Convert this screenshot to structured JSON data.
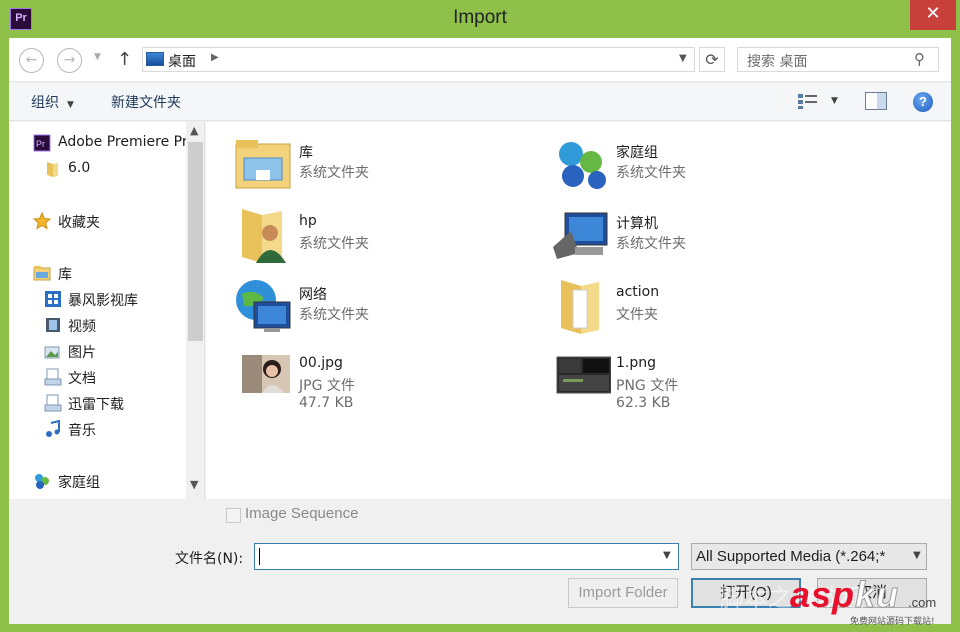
{
  "window": {
    "title": "Import",
    "app_icon_text": "Pr",
    "close_glyph": "✕"
  },
  "nav": {
    "back_glyph": "←",
    "forward_glyph": "→",
    "up_glyph": "↑",
    "address_path": "桌面",
    "refresh_glyph": "⟳",
    "search_placeholder": "搜索 桌面"
  },
  "toolbar": {
    "organize_label": "组织",
    "new_folder_label": "新建文件夹",
    "help_glyph": "?"
  },
  "sidebar": {
    "items": [
      {
        "label": "Adobe Premiere Pro",
        "icon": "premiere-icon"
      },
      {
        "label": "6.0",
        "icon": "folder-icon"
      },
      {
        "label": "收藏夹",
        "icon": "star-icon"
      },
      {
        "label": "库",
        "icon": "library-icon"
      },
      {
        "label": "暴风影视库",
        "icon": "video-library-icon"
      },
      {
        "label": "视频",
        "icon": "video-icon"
      },
      {
        "label": "图片",
        "icon": "pictures-icon"
      },
      {
        "label": "文档",
        "icon": "documents-icon"
      },
      {
        "label": "迅雷下载",
        "icon": "download-icon"
      },
      {
        "label": "音乐",
        "icon": "music-icon"
      },
      {
        "label": "家庭组",
        "icon": "homegroup-icon"
      }
    ]
  },
  "files": [
    {
      "name": "库",
      "type": "系统文件夹",
      "icon": "library-folder-icon"
    },
    {
      "name": "家庭组",
      "type": "系统文件夹",
      "icon": "homegroup-icon"
    },
    {
      "name": "hp",
      "type": "系统文件夹",
      "icon": "user-folder-icon"
    },
    {
      "name": "计算机",
      "type": "系统文件夹",
      "icon": "computer-icon"
    },
    {
      "name": "网络",
      "type": "系统文件夹",
      "icon": "network-icon"
    },
    {
      "name": "action",
      "type": "文件夹",
      "icon": "folder-icon"
    },
    {
      "name": "00.jpg",
      "type": "JPG 文件",
      "size": "47.7 KB",
      "icon": "photo-thumbnail"
    },
    {
      "name": "1.png",
      "type": "PNG 文件",
      "size": "62.3 KB",
      "icon": "screenshot-thumbnail"
    }
  ],
  "bottom": {
    "image_sequence_label": "Image Sequence",
    "filename_label": "文件名(N):",
    "filename_value": "",
    "filter_value": "All Supported Media (*.264;*",
    "import_folder_label": "Import Folder",
    "open_label": "打开(O)",
    "cancel_label": "取消"
  },
  "watermark": {
    "brand": "asp",
    "brand2": "ku",
    "domain": ".com",
    "subtitle": "免费网站源码下载站!",
    "ghost": "脚本之家教程"
  },
  "colors": {
    "frame": "#8ec04a",
    "close": "#c7413a",
    "accent": "#3c7fb1",
    "watermark_red": "#e8112d"
  }
}
